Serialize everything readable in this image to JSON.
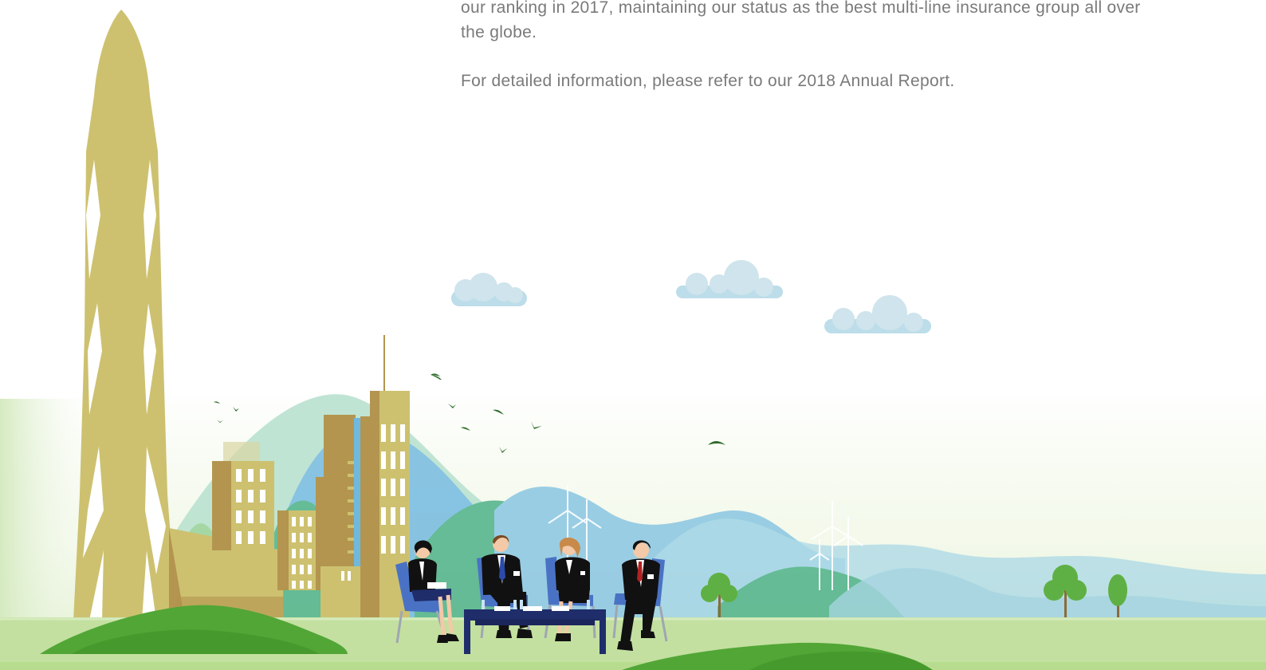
{
  "content": {
    "paragraph_1": "our ranking in 2017, maintaining our status as the best multi-line insurance group all over the globe.",
    "paragraph_2": "For detailed information, please refer to our 2018 Annual Report."
  },
  "colors": {
    "text": "#7a7a7a",
    "tower": "#cdc170",
    "building_dark": "#b3954f",
    "building_light": "#cdc170",
    "hill_green": "#55b58d",
    "hill_blue": "#7bbde0",
    "grass": "#b8dc8f",
    "bush": "#52a636",
    "cloud": "#cfe4ec",
    "table": "#1f2d6b",
    "chair": "#4a72c4"
  },
  "icons": {
    "cloud": "cloud-icon",
    "bird": "bird-icon",
    "tree": "tree-icon",
    "wind_turbine": "wind-turbine-icon"
  }
}
